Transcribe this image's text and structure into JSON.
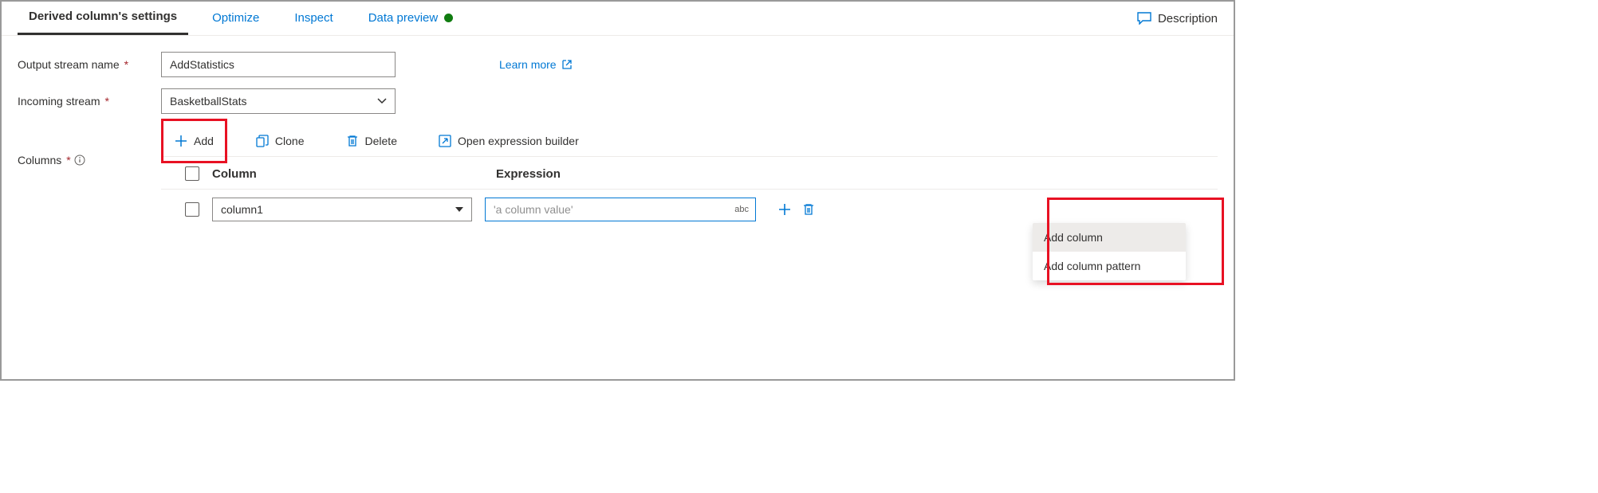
{
  "tabs": {
    "settings": "Derived column's settings",
    "optimize": "Optimize",
    "inspect": "Inspect",
    "data_preview": "Data preview"
  },
  "description_link": "Description",
  "labels": {
    "output_stream": "Output stream name",
    "incoming_stream": "Incoming stream",
    "columns": "Columns"
  },
  "values": {
    "output_stream": "AddStatistics",
    "incoming_stream": "BasketballStats"
  },
  "learn_more": "Learn more",
  "toolbar": {
    "add": "Add",
    "clone": "Clone",
    "delete": "Delete",
    "open_builder": "Open expression builder"
  },
  "headers": {
    "column": "Column",
    "expression": "Expression"
  },
  "row": {
    "column_name": "column1",
    "expression_placeholder": "'a column value'",
    "abc": "abc"
  },
  "menu": {
    "add_column": "Add column",
    "add_column_pattern": "Add column pattern"
  }
}
